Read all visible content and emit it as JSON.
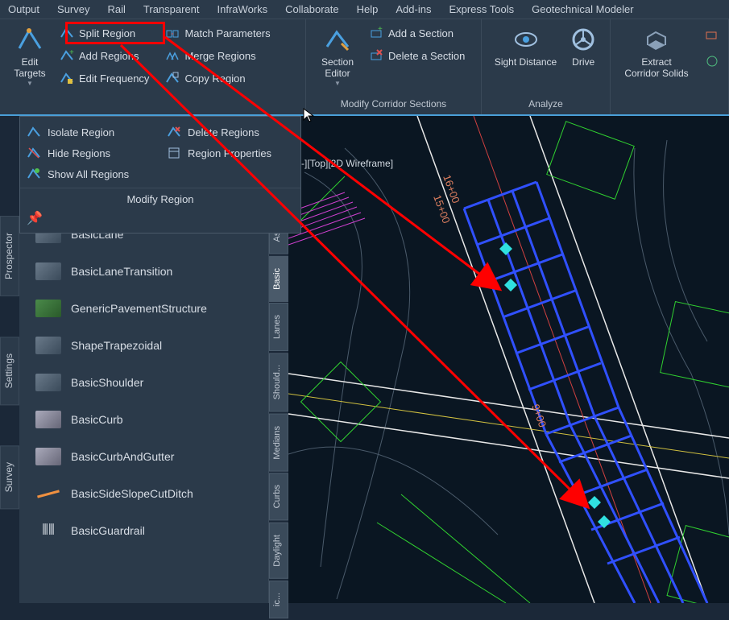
{
  "menu": [
    "Output",
    "Survey",
    "Rail",
    "Transparent",
    "InfraWorks",
    "Collaborate",
    "Help",
    "Add-ins",
    "Express Tools",
    "Geotechnical Modeler"
  ],
  "ribbon": {
    "editTargets": "Edit\nTargets",
    "splitRegion": "Split Region",
    "addRegions": "Add Regions",
    "editFrequency": "Edit Frequency",
    "matchParameters": "Match Parameters",
    "mergeRegions": "Merge Regions",
    "copyRegion": "Copy Region",
    "sectionEditor": "Section\nEditor",
    "addSection": "Add a Section",
    "deleteSection": "Delete a Section",
    "modifyCorridorSections": "Modify Corridor Sections",
    "sightDistance": "Sight Distance",
    "drive": "Drive",
    "analyze": "Analyze",
    "extractCorridorSolids": "Extract\nCorridor Solids"
  },
  "dropdown": {
    "isolateRegion": "Isolate Region",
    "hideRegions": "Hide Regions",
    "showAllRegions": "Show All Regions",
    "deleteRegions": "Delete Regions",
    "regionProperties": "Region Properties",
    "title": "Modify Region"
  },
  "leftTabs": {
    "prospector": "Prospector",
    "settings": "Settings",
    "survey": "Survey"
  },
  "rightTabs": [
    "Ass...",
    "Basic",
    "Lanes",
    "Should...",
    "Medians",
    "Curbs",
    "Daylight",
    "ic..."
  ],
  "palette": [
    "BasicLane",
    "BasicLaneTransition",
    "GenericPavementStructure",
    "ShapeTrapezoidal",
    "BasicShoulder",
    "BasicCurb",
    "BasicCurbAndGutter",
    "BasicSideSlopeCutDitch",
    "BasicGuardrail"
  ],
  "viewport": {
    "viewLabel": "-][Top][2D Wireframe]",
    "stations": [
      "16+00",
      "15+00",
      "9+00"
    ]
  }
}
